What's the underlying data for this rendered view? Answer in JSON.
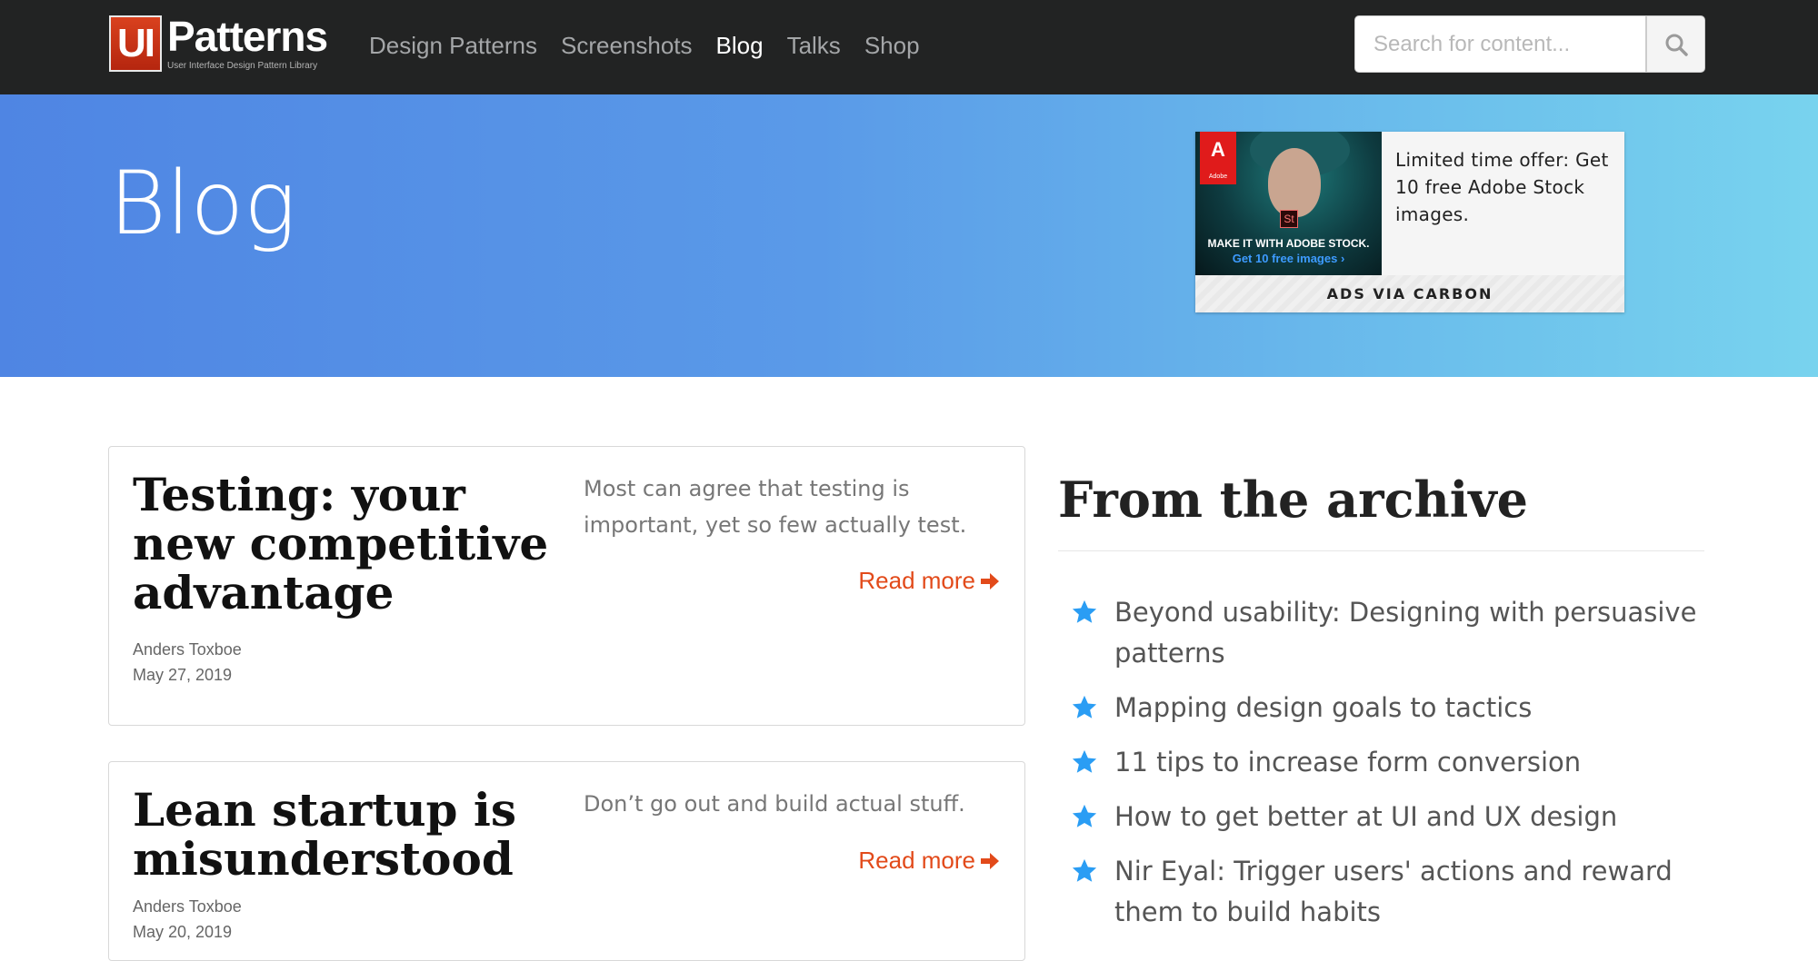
{
  "nav": {
    "logo_mark": "UI",
    "logo_name": "Patterns",
    "logo_tagline": "User Interface Design Pattern Library",
    "links": [
      {
        "label": "Design Patterns"
      },
      {
        "label": "Screenshots"
      },
      {
        "label": "Blog"
      },
      {
        "label": "Talks"
      },
      {
        "label": "Shop"
      }
    ],
    "active_link": "Blog",
    "search_placeholder": "Search for content...",
    "search_value": ""
  },
  "hero": {
    "title": "Blog"
  },
  "ad": {
    "brand_logo": "Adobe",
    "image_badge": "St",
    "image_caption": "MAKE IT WITH ADOBE STOCK.",
    "image_link": "Get 10 free images ›",
    "text": "Limited time offer: Get 10 free Adobe Stock images.",
    "footer": "ADS VIA CARBON"
  },
  "posts": [
    {
      "title": "Testing: your new competitive advantage",
      "author": "Anders Toxboe",
      "date": "May 27, 2019",
      "excerpt": "Most can agree that testing is important, yet so few actually test.",
      "read_more": "Read more"
    },
    {
      "title": "Lean startup is misunderstood",
      "author": "Anders Toxboe",
      "date": "May 20, 2019",
      "excerpt": "Don’t go out and build actual stuff.",
      "read_more": "Read more"
    }
  ],
  "archive": {
    "title": "From the archive",
    "items": [
      "Beyond usability: Designing with persuasive patterns",
      "Mapping design goals to tactics",
      "11 tips to increase form conversion",
      "How to get better at UI and UX design",
      "Nir Eyal: Trigger users' actions and reward them to build habits"
    ]
  },
  "colors": {
    "navbar_bg": "#222323",
    "accent_link": "#e24a1a",
    "star": "#2a9df4",
    "hero_gradient_start": "#4f85e3",
    "hero_gradient_end": "#78d3ee"
  }
}
